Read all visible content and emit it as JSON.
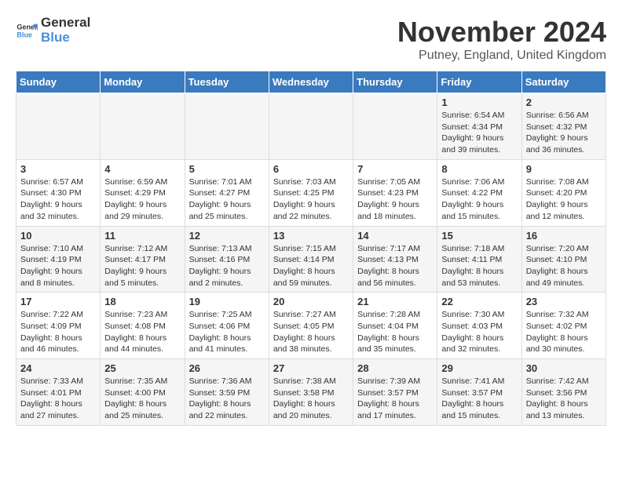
{
  "logo": {
    "general": "General",
    "blue": "Blue"
  },
  "title": "November 2024",
  "subtitle": "Putney, England, United Kingdom",
  "days_of_week": [
    "Sunday",
    "Monday",
    "Tuesday",
    "Wednesday",
    "Thursday",
    "Friday",
    "Saturday"
  ],
  "weeks": [
    [
      {
        "day": "",
        "info": ""
      },
      {
        "day": "",
        "info": ""
      },
      {
        "day": "",
        "info": ""
      },
      {
        "day": "",
        "info": ""
      },
      {
        "day": "",
        "info": ""
      },
      {
        "day": "1",
        "info": "Sunrise: 6:54 AM\nSunset: 4:34 PM\nDaylight: 9 hours and 39 minutes."
      },
      {
        "day": "2",
        "info": "Sunrise: 6:56 AM\nSunset: 4:32 PM\nDaylight: 9 hours and 36 minutes."
      }
    ],
    [
      {
        "day": "3",
        "info": "Sunrise: 6:57 AM\nSunset: 4:30 PM\nDaylight: 9 hours and 32 minutes."
      },
      {
        "day": "4",
        "info": "Sunrise: 6:59 AM\nSunset: 4:29 PM\nDaylight: 9 hours and 29 minutes."
      },
      {
        "day": "5",
        "info": "Sunrise: 7:01 AM\nSunset: 4:27 PM\nDaylight: 9 hours and 25 minutes."
      },
      {
        "day": "6",
        "info": "Sunrise: 7:03 AM\nSunset: 4:25 PM\nDaylight: 9 hours and 22 minutes."
      },
      {
        "day": "7",
        "info": "Sunrise: 7:05 AM\nSunset: 4:23 PM\nDaylight: 9 hours and 18 minutes."
      },
      {
        "day": "8",
        "info": "Sunrise: 7:06 AM\nSunset: 4:22 PM\nDaylight: 9 hours and 15 minutes."
      },
      {
        "day": "9",
        "info": "Sunrise: 7:08 AM\nSunset: 4:20 PM\nDaylight: 9 hours and 12 minutes."
      }
    ],
    [
      {
        "day": "10",
        "info": "Sunrise: 7:10 AM\nSunset: 4:19 PM\nDaylight: 9 hours and 8 minutes."
      },
      {
        "day": "11",
        "info": "Sunrise: 7:12 AM\nSunset: 4:17 PM\nDaylight: 9 hours and 5 minutes."
      },
      {
        "day": "12",
        "info": "Sunrise: 7:13 AM\nSunset: 4:16 PM\nDaylight: 9 hours and 2 minutes."
      },
      {
        "day": "13",
        "info": "Sunrise: 7:15 AM\nSunset: 4:14 PM\nDaylight: 8 hours and 59 minutes."
      },
      {
        "day": "14",
        "info": "Sunrise: 7:17 AM\nSunset: 4:13 PM\nDaylight: 8 hours and 56 minutes."
      },
      {
        "day": "15",
        "info": "Sunrise: 7:18 AM\nSunset: 4:11 PM\nDaylight: 8 hours and 53 minutes."
      },
      {
        "day": "16",
        "info": "Sunrise: 7:20 AM\nSunset: 4:10 PM\nDaylight: 8 hours and 49 minutes."
      }
    ],
    [
      {
        "day": "17",
        "info": "Sunrise: 7:22 AM\nSunset: 4:09 PM\nDaylight: 8 hours and 46 minutes."
      },
      {
        "day": "18",
        "info": "Sunrise: 7:23 AM\nSunset: 4:08 PM\nDaylight: 8 hours and 44 minutes."
      },
      {
        "day": "19",
        "info": "Sunrise: 7:25 AM\nSunset: 4:06 PM\nDaylight: 8 hours and 41 minutes."
      },
      {
        "day": "20",
        "info": "Sunrise: 7:27 AM\nSunset: 4:05 PM\nDaylight: 8 hours and 38 minutes."
      },
      {
        "day": "21",
        "info": "Sunrise: 7:28 AM\nSunset: 4:04 PM\nDaylight: 8 hours and 35 minutes."
      },
      {
        "day": "22",
        "info": "Sunrise: 7:30 AM\nSunset: 4:03 PM\nDaylight: 8 hours and 32 minutes."
      },
      {
        "day": "23",
        "info": "Sunrise: 7:32 AM\nSunset: 4:02 PM\nDaylight: 8 hours and 30 minutes."
      }
    ],
    [
      {
        "day": "24",
        "info": "Sunrise: 7:33 AM\nSunset: 4:01 PM\nDaylight: 8 hours and 27 minutes."
      },
      {
        "day": "25",
        "info": "Sunrise: 7:35 AM\nSunset: 4:00 PM\nDaylight: 8 hours and 25 minutes."
      },
      {
        "day": "26",
        "info": "Sunrise: 7:36 AM\nSunset: 3:59 PM\nDaylight: 8 hours and 22 minutes."
      },
      {
        "day": "27",
        "info": "Sunrise: 7:38 AM\nSunset: 3:58 PM\nDaylight: 8 hours and 20 minutes."
      },
      {
        "day": "28",
        "info": "Sunrise: 7:39 AM\nSunset: 3:57 PM\nDaylight: 8 hours and 17 minutes."
      },
      {
        "day": "29",
        "info": "Sunrise: 7:41 AM\nSunset: 3:57 PM\nDaylight: 8 hours and 15 minutes."
      },
      {
        "day": "30",
        "info": "Sunrise: 7:42 AM\nSunset: 3:56 PM\nDaylight: 8 hours and 13 minutes."
      }
    ]
  ]
}
